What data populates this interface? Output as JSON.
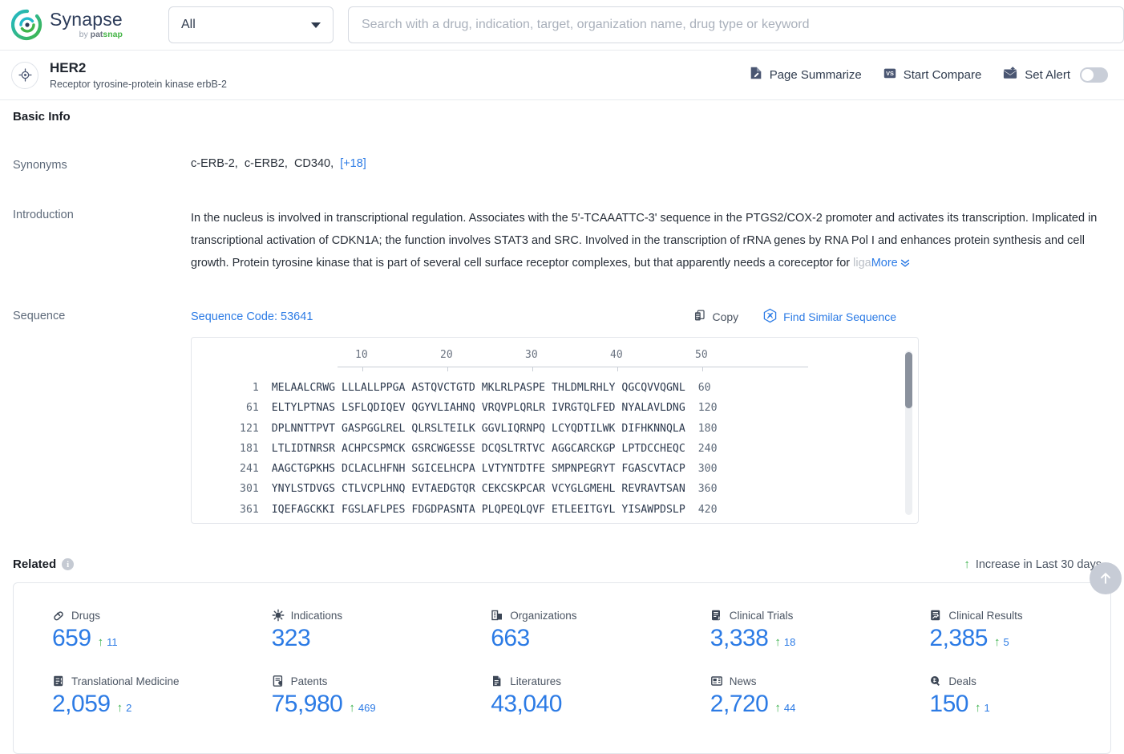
{
  "brand": {
    "name": "Synapse",
    "by": "by",
    "pat": "pat",
    "snap": "snap",
    "accent_blue": "#2c7be5",
    "accent_green": "#3eb34f",
    "logo_icon": "synapse-swirl-logo"
  },
  "search": {
    "scope_value": "All",
    "placeholder": "Search with a drug, indication, target, organization name, drug type or keyword",
    "value": ""
  },
  "entity": {
    "icon": "target-crosshair-icon",
    "title": "HER2",
    "subtitle": "Receptor tyrosine-protein kinase erbB-2",
    "actions": [
      {
        "label": "Page Summarize",
        "icon": "page-summarize-icon"
      },
      {
        "label": "Start Compare",
        "icon": "vs-compare-icon"
      },
      {
        "label": "Set Alert",
        "icon": "alert-mail-icon",
        "toggle_on": false
      }
    ]
  },
  "basic_info": {
    "title": "Basic Info",
    "synonyms_label": "Synonyms",
    "synonyms": [
      "c-ERB-2",
      "c-ERB2",
      "CD340"
    ],
    "synonyms_more": "[+18]",
    "introduction_label": "Introduction",
    "introduction": "In the nucleus is involved in transcriptional regulation. Associates with the 5'-TCAAATTC-3' sequence in the PTGS2/COX-2 promoter and activates its transcription. Implicated in transcriptional activation of CDKN1A; the function involves STAT3 and SRC. Involved in the transcription of rRNA genes by RNA Pol I and enhances protein synthesis and cell growth. Protein tyrosine kinase that is part of several cell surface receptor complexes, but that apparently needs a coreceptor for",
    "introduction_faded": "liga",
    "more_label": "More"
  },
  "sequence": {
    "label": "Sequence",
    "code_label": "Sequence Code: 53641",
    "copy_label": "Copy",
    "copy_icon": "copy-icon",
    "find_similar_label": "Find Similar Sequence",
    "find_similar_icon": "find-similar-sequence-icon",
    "ruler_ticks": [
      "10",
      "20",
      "30",
      "40",
      "50"
    ],
    "rows": [
      {
        "start": "1",
        "blocks": [
          "MELAALCRWG",
          "LLLALLPPGA",
          "ASTQVCTGTD",
          "MKLRLPASPE",
          "THLDMLRHLY",
          "QGCQVVQGNL"
        ],
        "end": "60"
      },
      {
        "start": "61",
        "blocks": [
          "ELTYLPTNAS",
          "LSFLQDIQEV",
          "QGYVLIAHNQ",
          "VRQVPLQRLR",
          "IVRGTQLFED",
          "NYALAVLDNG"
        ],
        "end": "120"
      },
      {
        "start": "121",
        "blocks": [
          "DPLNNTTPVT",
          "GASPGGLREL",
          "QLRSLTEILK",
          "GGVLIQRNPQ",
          "LCYQDTILWK",
          "DIFHKNNQLA"
        ],
        "end": "180"
      },
      {
        "start": "181",
        "blocks": [
          "LTLIDTNRSR",
          "ACHPCSPMCK",
          "GSRCWGESSE",
          "DCQSLTRTVC",
          "AGGCARCKGP",
          "LPTDCCHEQC"
        ],
        "end": "240"
      },
      {
        "start": "241",
        "blocks": [
          "AAGCTGPKHS",
          "DCLACLHFNH",
          "SGICELHCPA",
          "LVTYNTDTFE",
          "SMPNPEGRYT",
          "FGASCVTACP"
        ],
        "end": "300"
      },
      {
        "start": "301",
        "blocks": [
          "YNYLSTDVGS",
          "CTLVCPLHNQ",
          "EVTAEDGTQR",
          "CEKCSKPCAR",
          "VCYGLGMEHL",
          "REVRAVTSAN"
        ],
        "end": "360"
      },
      {
        "start": "361",
        "blocks": [
          "IQEFAGCKKI",
          "FGSLAFLPES",
          "FDGDPASNTA",
          "PLQPEQLQVF",
          "ETLEEITGYL",
          "YISAWPDSLP"
        ],
        "end": "420"
      }
    ]
  },
  "related": {
    "title": "Related",
    "info_icon": "info-icon",
    "legend": "Increase in Last 30 days",
    "legend_icon": "up-arrow-icon",
    "scroll_top_icon": "scroll-to-top-icon",
    "stats": [
      {
        "label": "Drugs",
        "icon": "drug-capsule-icon",
        "value": "659",
        "delta": "11"
      },
      {
        "label": "Indications",
        "icon": "virus-icon",
        "value": "323",
        "delta": ""
      },
      {
        "label": "Organizations",
        "icon": "organization-icon",
        "value": "663",
        "delta": ""
      },
      {
        "label": "Clinical Trials",
        "icon": "clinical-trial-icon",
        "value": "3,338",
        "delta": "18"
      },
      {
        "label": "Clinical Results",
        "icon": "clinical-result-icon",
        "value": "2,385",
        "delta": "5"
      },
      {
        "label": "Translational Medicine",
        "icon": "translational-med-icon",
        "value": "2,059",
        "delta": "2"
      },
      {
        "label": "Patents",
        "icon": "patent-icon",
        "value": "75,980",
        "delta": "469"
      },
      {
        "label": "Literatures",
        "icon": "literature-icon",
        "value": "43,040",
        "delta": ""
      },
      {
        "label": "News",
        "icon": "news-icon",
        "value": "2,720",
        "delta": "44"
      },
      {
        "label": "Deals",
        "icon": "deal-icon",
        "value": "150",
        "delta": "1"
      }
    ]
  }
}
